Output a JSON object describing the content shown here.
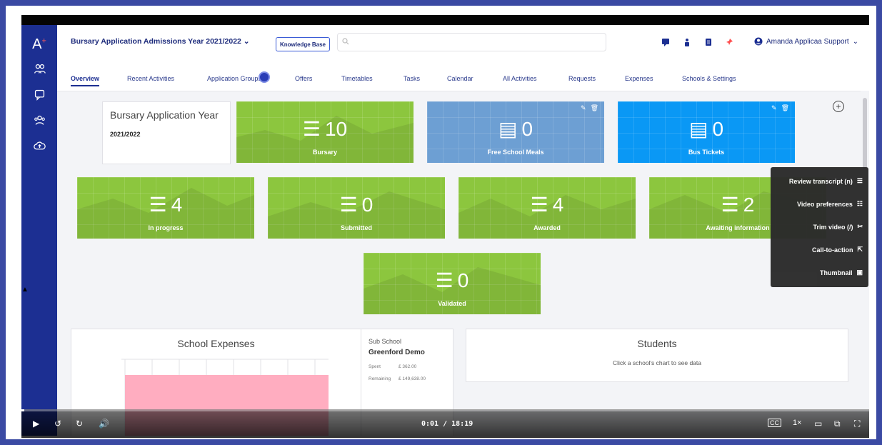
{
  "header": {
    "logo": "A",
    "title": "Bursary Application Admissions Year 2021/2022",
    "knowledge_base": "Knowledge Base",
    "user": "Amanda Applicaa Support"
  },
  "tabs": [
    "Overview",
    "Recent Activities",
    "Application Groups",
    "Offers",
    "Timetables",
    "Tasks",
    "Calendar",
    "All Activities",
    "Requests",
    "Expenses",
    "Schools & Settings"
  ],
  "info_card": {
    "heading": "Bursary Application Year",
    "year": "2021/2022"
  },
  "tiles": [
    {
      "value": "10",
      "label": "Bursary"
    },
    {
      "value": "0",
      "label": "Free School Meals"
    },
    {
      "value": "0",
      "label": "Bus Tickets"
    },
    {
      "value": "4",
      "label": "In progress"
    },
    {
      "value": "0",
      "label": "Submitted"
    },
    {
      "value": "4",
      "label": "Awarded"
    },
    {
      "value": "2",
      "label": "Awaiting information"
    },
    {
      "value": "0",
      "label": "Validated"
    }
  ],
  "expenses": {
    "heading": "School Expenses"
  },
  "sub_school": {
    "label": "Sub School",
    "name": "Greenford Demo",
    "spent_label": "Spent",
    "spent": "£ 362.00",
    "remaining_label": "Remaining",
    "remaining": "£ 149,638.00"
  },
  "students": {
    "heading": "Students",
    "hint": "Click a school's chart to see data"
  },
  "video_menu": {
    "review": "Review transcript (n)",
    "prefs": "Video preferences",
    "trim": "Trim video (/)",
    "cta": "Call-to-action",
    "thumb": "Thumbnail"
  },
  "player": {
    "time": "0:01 / 18:19",
    "speed": "1×",
    "progress": 0.001
  },
  "colors": {
    "rail": "#1c2f92",
    "green": "#8cc63e",
    "steel": "#6d9fd3",
    "blue": "#0a98f5"
  }
}
